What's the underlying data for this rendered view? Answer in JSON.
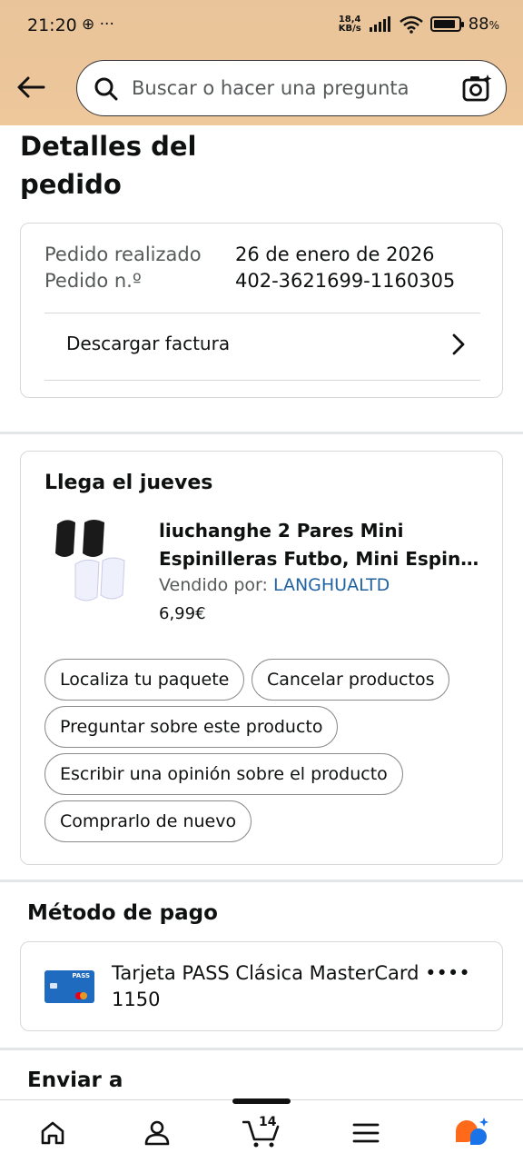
{
  "status_bar": {
    "time": "21:20",
    "extra_icons": "⊕ ···",
    "net_speed_top": "18,4",
    "net_speed_bottom": "KB/s",
    "battery": "88",
    "battery_unit": "%",
    "battery_level": 0.88
  },
  "search": {
    "placeholder": "Buscar o hacer una pregunta"
  },
  "page_title": "Detalles del pedido",
  "order": {
    "placed_label": "Pedido realizado",
    "placed_value": "26 de enero de 2026",
    "number_label": "Pedido n.º",
    "number_value": "402-3621699-1160305",
    "invoice_label": "Descargar factura"
  },
  "shipment": {
    "arrival": "Llega el jueves",
    "product_line1": "liuchanghe 2 Pares Mini",
    "product_line2": "Espinilleras Futbo, Mini Espin…",
    "sold_by_label": "Vendido por:",
    "seller": "LANGHUALTD",
    "price": "6,99€",
    "actions": {
      "track": "Localiza tu paquete",
      "cancel": "Cancelar productos",
      "ask": "Preguntar sobre este producto",
      "review": "Escribir una opinión sobre el producto",
      "buy_again": "Comprarlo de nuevo"
    }
  },
  "payment": {
    "title": "Método de pago",
    "card_line1": "Tarjeta PASS Clásica MasterCard ••••",
    "card_line2": "1150",
    "card_brand_text": "PASS"
  },
  "ship_to": {
    "title": "Enviar a"
  },
  "bottom_nav": {
    "cart_count": "14"
  },
  "colors": {
    "header_bg": "#eec79b",
    "link": "#2162a1",
    "ai_orange": "#ff6a1a",
    "ai_blue": "#1a73e8",
    "card_blue": "#1f6bbf"
  }
}
